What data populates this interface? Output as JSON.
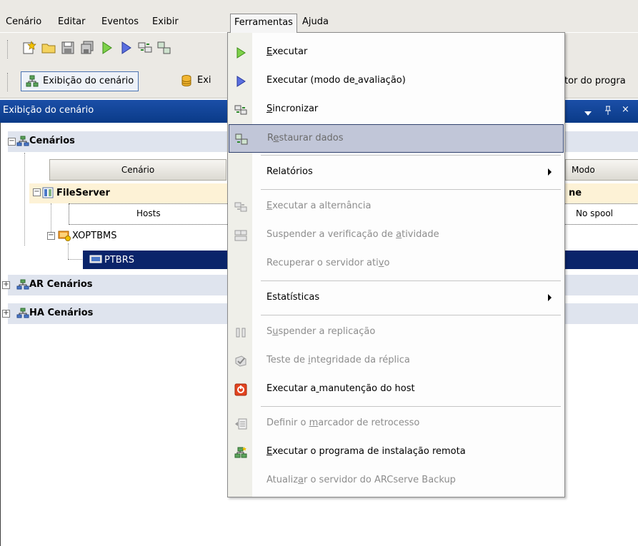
{
  "menubar": {
    "items": [
      "Cenário",
      "Editar",
      "Eventos",
      "Exibir",
      "Ferramentas",
      "Ajuda"
    ]
  },
  "toolbar2": {
    "scenario_view": "Exibição do cenário",
    "partial_label": "Exi",
    "right_partial": "tor do progra"
  },
  "panel": {
    "title": "Exibição do cenário",
    "pin": "ᵠ",
    "close": "×"
  },
  "tree": {
    "groups": [
      "Cenários",
      "AR Cenários",
      "HA Cenários"
    ],
    "columns": {
      "scenario": "Cenário",
      "mode": "Modo"
    },
    "fileserver": {
      "name": "FileServer",
      "mode_partial": "ne"
    },
    "hosts_header": "Hosts",
    "hosts_right": "No spool",
    "host_master": "XOPTBMS",
    "host_replica": "PTBRS"
  },
  "dropdown": {
    "items": [
      {
        "label": "Executar",
        "u": 0,
        "enabled": true,
        "icon": "play-green-icon"
      },
      {
        "label": "Executar (modo de avaliação)",
        "u": 17,
        "enabled": true,
        "icon": "play-blue-icon"
      },
      {
        "label": "Sincronizar",
        "u": 0,
        "enabled": true,
        "icon": "sync-icon"
      },
      {
        "label": "Restaurar dados",
        "u": 1,
        "enabled": true,
        "highlighted": true,
        "icon": "restore-icon"
      },
      {
        "label": "Relatórios",
        "u": -1,
        "enabled": true,
        "submenu": true
      },
      {
        "label": "Executar a alternância",
        "u": 0,
        "enabled": false,
        "icon": "switchover-icon"
      },
      {
        "label": "Suspender a verificação de atividade",
        "u": 27,
        "enabled": false,
        "icon": "suspend-check-icon"
      },
      {
        "label": "Recuperar o servidor ativo",
        "u": 24,
        "enabled": false
      },
      {
        "label": "Estatísticas",
        "u": -1,
        "enabled": true,
        "submenu": true
      },
      {
        "label": "Suspender a replicação",
        "u": 1,
        "enabled": false,
        "icon": "pause-icon"
      },
      {
        "label": "Teste de integridade da réplica",
        "u": 9,
        "enabled": false,
        "icon": "integrity-icon"
      },
      {
        "label": "Executar a manutenção do host",
        "u": 10,
        "enabled": true,
        "icon": "maintenance-icon"
      },
      {
        "label": "Definir o marcador de retrocesso",
        "u": 10,
        "enabled": false,
        "icon": "bookmark-icon"
      },
      {
        "label": "Executar o programa de instalação remota",
        "u": 0,
        "enabled": true,
        "icon": "remote-install-icon"
      },
      {
        "label": "Atualizar o servidor do ARCserve Backup",
        "u": 7,
        "enabled": false
      }
    ]
  }
}
